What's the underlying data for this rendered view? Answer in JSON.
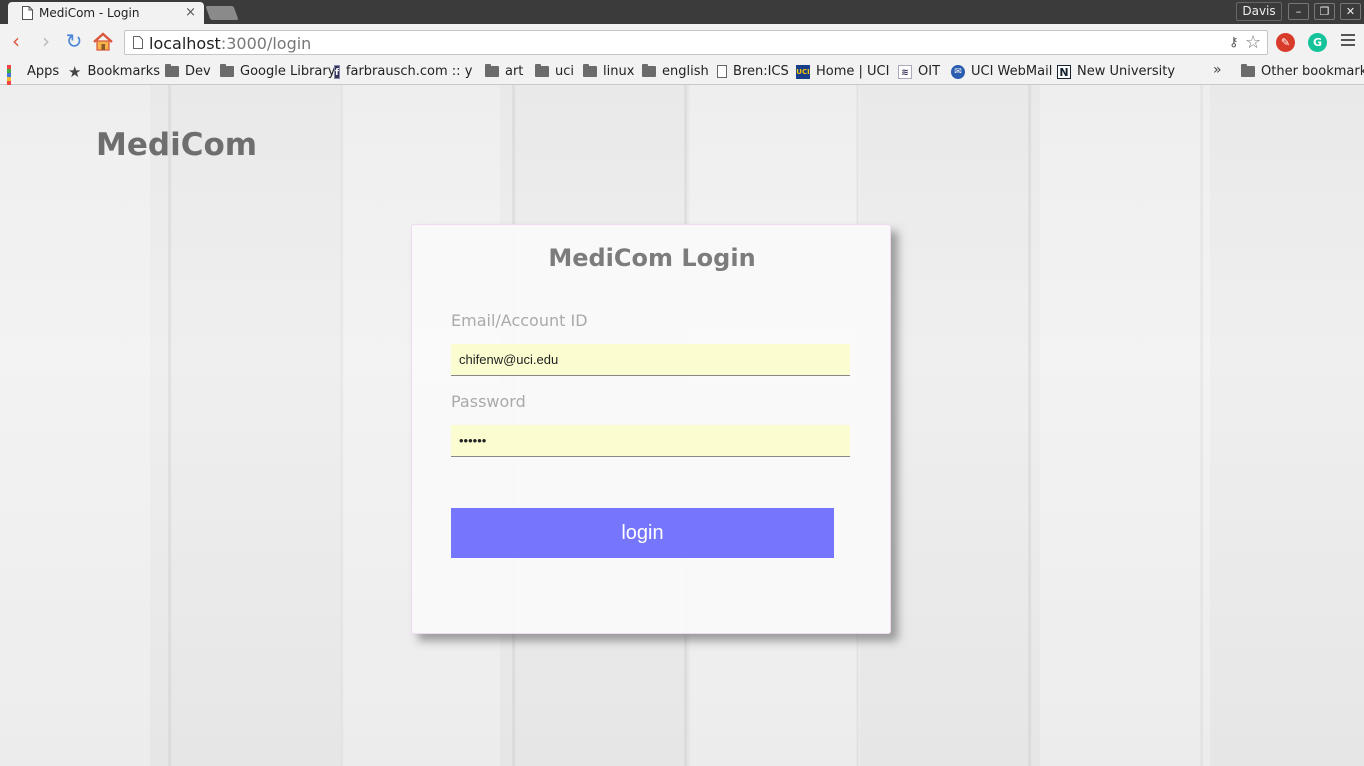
{
  "browser": {
    "tab_title": "MediCom - Login",
    "tab_close": "×",
    "profile_name": "Davis",
    "url_host": "localhost",
    "url_path": ":3000/login",
    "window_buttons": {
      "minimize": "–",
      "restore": "❐",
      "close": "✕"
    }
  },
  "bookmarks": [
    {
      "label": "Apps",
      "icon": "apps-grid-icon"
    },
    {
      "label": "Bookmarks",
      "icon": "star-icon"
    },
    {
      "label": "Dev",
      "icon": "folder-icon"
    },
    {
      "label": "Google Library",
      "icon": "folder-icon"
    },
    {
      "label": "farbrausch.com :: yo",
      "icon": "site-favicon"
    },
    {
      "label": "art",
      "icon": "folder-icon"
    },
    {
      "label": "uci",
      "icon": "folder-icon"
    },
    {
      "label": "linux",
      "icon": "folder-icon"
    },
    {
      "label": "english",
      "icon": "folder-icon"
    },
    {
      "label": "Bren:ICS",
      "icon": "page-icon"
    },
    {
      "label": "Home | UCI",
      "icon": "uci-favicon"
    },
    {
      "label": "OIT",
      "icon": "oit-favicon"
    },
    {
      "label": "UCI WebMail",
      "icon": "webmail-favicon"
    },
    {
      "label": "New University",
      "icon": "n-favicon"
    },
    {
      "label": "Other bookmarks",
      "icon": "folder-icon"
    }
  ],
  "bookmarks_overflow": "»",
  "page": {
    "site_title": "MediCom",
    "login_card": {
      "title": "MediCom Login",
      "email_label": "Email/Account ID",
      "email_value": "chifenw@uci.edu",
      "password_label": "Password",
      "password_value": "••••••",
      "login_button": "login"
    }
  },
  "colors": {
    "login_button": "#7676fc",
    "input_autofill": "#fbfdd1",
    "title_text": "#6e6e6e"
  }
}
